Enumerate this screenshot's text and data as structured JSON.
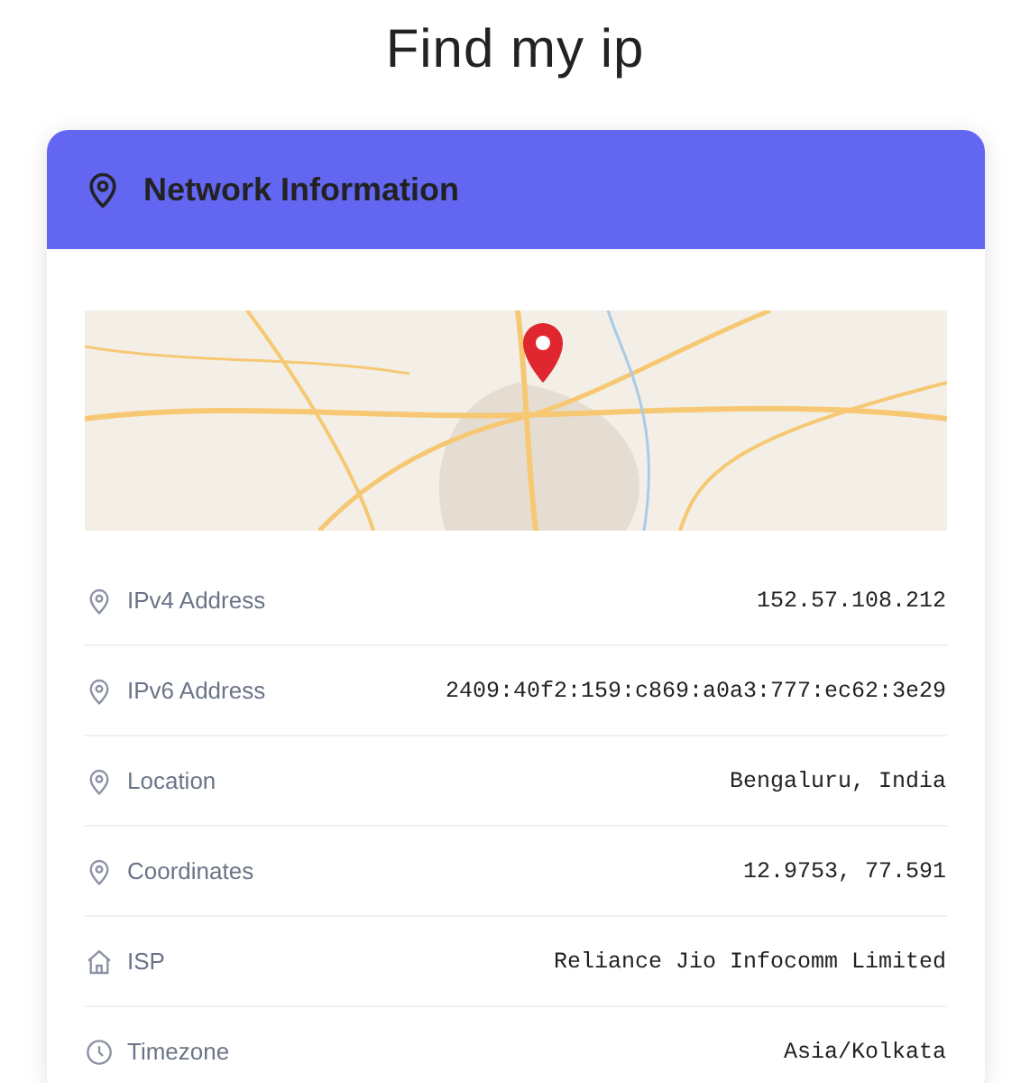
{
  "page": {
    "title": "Find my ip"
  },
  "card": {
    "title": "Network Information",
    "rows": [
      {
        "kind": "pin",
        "label": "IPv4 Address",
        "value": "152.57.108.212"
      },
      {
        "kind": "pin",
        "label": "IPv6 Address",
        "value": "2409:40f2:159:c869:a0a3:777:ec62:3e29"
      },
      {
        "kind": "pin",
        "label": "Location",
        "value": "Bengaluru, India"
      },
      {
        "kind": "pin",
        "label": "Coordinates",
        "value": "12.9753, 77.591"
      },
      {
        "kind": "home",
        "label": "ISP",
        "value": "Reliance Jio Infocomm Limited"
      },
      {
        "kind": "clock",
        "label": "Timezone",
        "value": "Asia/Kolkata"
      }
    ]
  }
}
